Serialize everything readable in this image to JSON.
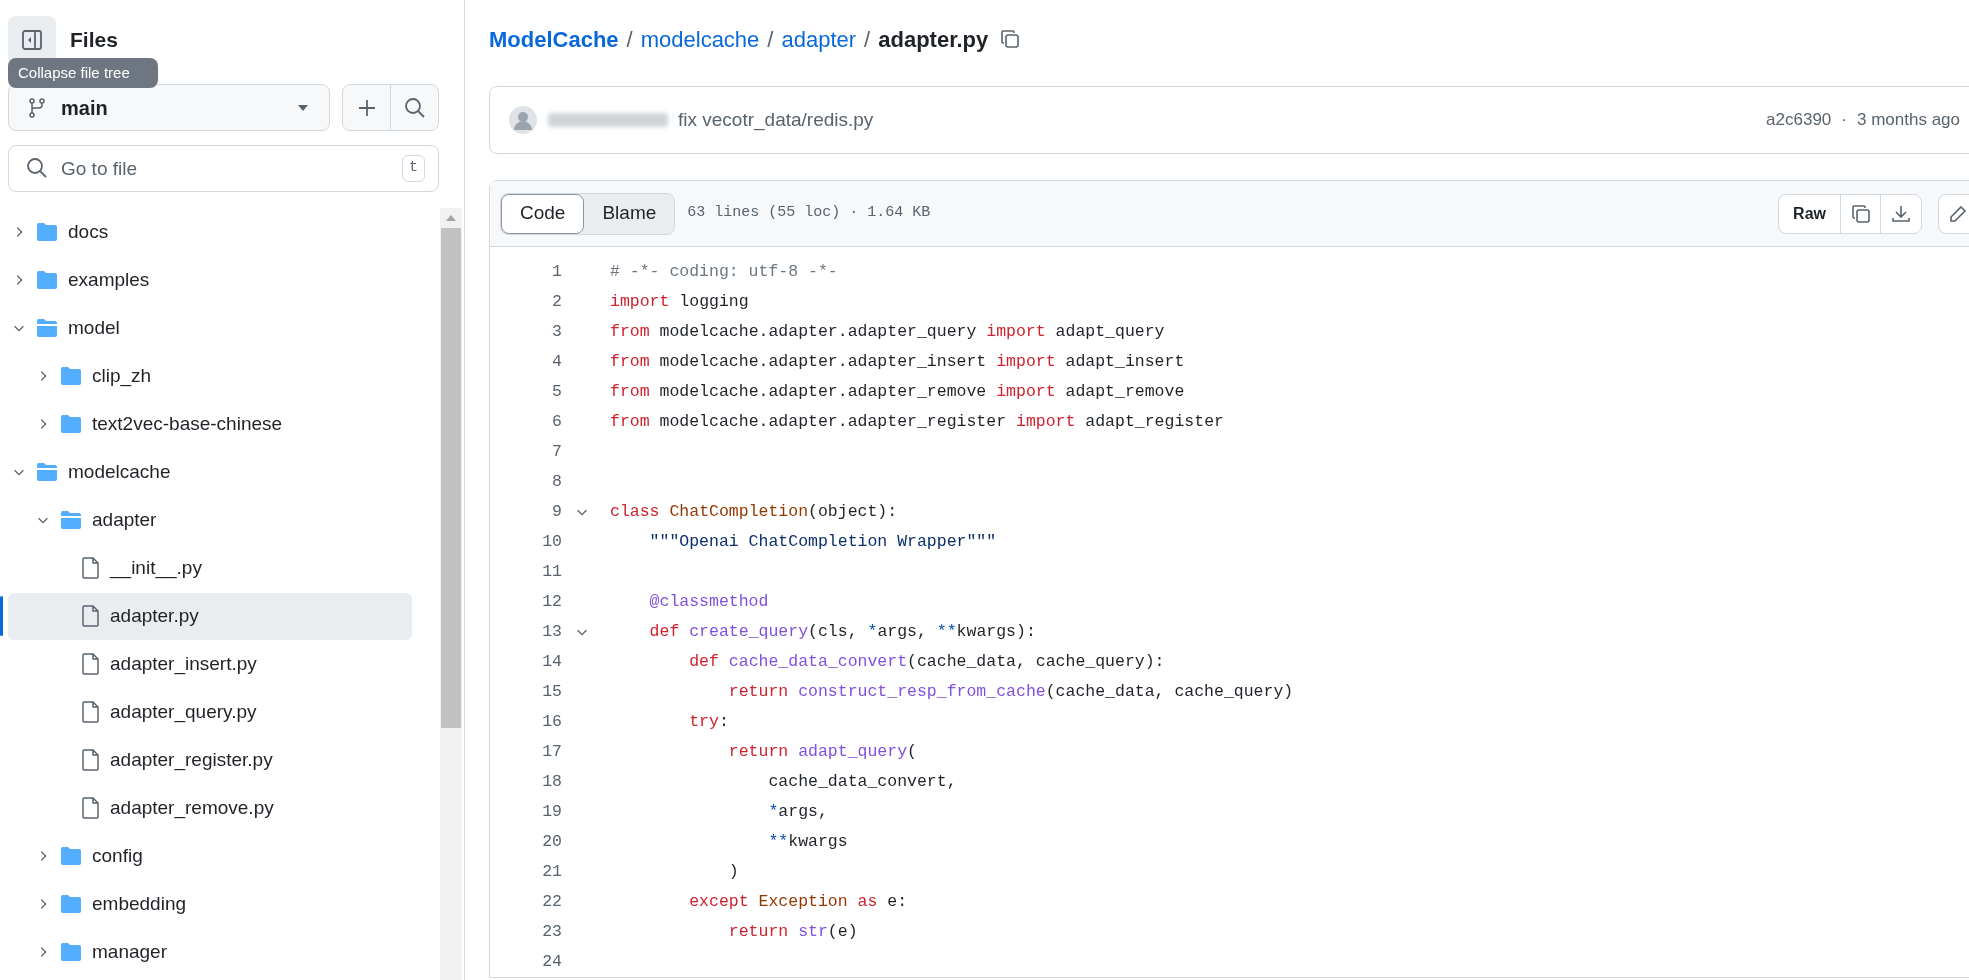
{
  "sidebar": {
    "title": "Files",
    "tooltip": "Collapse file tree",
    "branch": "main",
    "search": {
      "placeholder": "Go to file",
      "shortcut": "t"
    },
    "tree": [
      {
        "kind": "folder",
        "name": "docs",
        "expanded": false,
        "selected": false
      },
      {
        "kind": "folder",
        "name": "examples",
        "expanded": false,
        "selected": false
      },
      {
        "kind": "folder",
        "name": "model",
        "expanded": true,
        "selected": false,
        "children": [
          {
            "kind": "folder",
            "name": "clip_zh",
            "expanded": false,
            "selected": false
          },
          {
            "kind": "folder",
            "name": "text2vec-base-chinese",
            "expanded": false,
            "selected": false
          }
        ]
      },
      {
        "kind": "folder",
        "name": "modelcache",
        "expanded": true,
        "selected": false,
        "children": [
          {
            "kind": "folder",
            "name": "adapter",
            "expanded": true,
            "selected": false,
            "children": [
              {
                "kind": "file",
                "name": "__init__.py",
                "selected": false
              },
              {
                "kind": "file",
                "name": "adapter.py",
                "selected": true
              },
              {
                "kind": "file",
                "name": "adapter_insert.py",
                "selected": false
              },
              {
                "kind": "file",
                "name": "adapter_query.py",
                "selected": false
              },
              {
                "kind": "file",
                "name": "adapter_register.py",
                "selected": false
              },
              {
                "kind": "file",
                "name": "adapter_remove.py",
                "selected": false
              }
            ]
          },
          {
            "kind": "folder",
            "name": "config",
            "expanded": false,
            "selected": false
          },
          {
            "kind": "folder",
            "name": "embedding",
            "expanded": false,
            "selected": false
          },
          {
            "kind": "folder",
            "name": "manager",
            "expanded": false,
            "selected": false
          }
        ]
      }
    ]
  },
  "breadcrumb": {
    "links": [
      "ModelCache",
      "modelcache",
      "adapter"
    ],
    "separator": "/",
    "current": "adapter.py"
  },
  "commit": {
    "message": "fix vecotr_data/redis.py",
    "sha": "a2c6390",
    "separator": "·",
    "time": "3 months ago"
  },
  "file_header": {
    "tabs": [
      {
        "label": "Code",
        "selected": true
      },
      {
        "label": "Blame",
        "selected": false
      }
    ],
    "info": "63 lines (55 loc) · 1.64 KB",
    "raw": "Raw"
  },
  "code": [
    {
      "number": "1",
      "tokens": [
        {
          "kind": "comment",
          "text": "# -*- coding: utf-8 -*-"
        }
      ]
    },
    {
      "number": "2",
      "tokens": [
        {
          "kind": "keyword",
          "text": "import"
        },
        {
          "kind": "plain",
          "text": " logging"
        }
      ]
    },
    {
      "number": "3",
      "tokens": [
        {
          "kind": "keyword",
          "text": "from"
        },
        {
          "kind": "plain",
          "text": " modelcache.adapter.adapter_query "
        },
        {
          "kind": "keyword",
          "text": "import"
        },
        {
          "kind": "plain",
          "text": " adapt_query"
        }
      ]
    },
    {
      "number": "4",
      "tokens": [
        {
          "kind": "keyword",
          "text": "from"
        },
        {
          "kind": "plain",
          "text": " modelcache.adapter.adapter_insert "
        },
        {
          "kind": "keyword",
          "text": "import"
        },
        {
          "kind": "plain",
          "text": " adapt_insert"
        }
      ]
    },
    {
      "number": "5",
      "tokens": [
        {
          "kind": "keyword",
          "text": "from"
        },
        {
          "kind": "plain",
          "text": " modelcache.adapter.adapter_remove "
        },
        {
          "kind": "keyword",
          "text": "import"
        },
        {
          "kind": "plain",
          "text": " adapt_remove"
        }
      ]
    },
    {
      "number": "6",
      "tokens": [
        {
          "kind": "keyword",
          "text": "from"
        },
        {
          "kind": "plain",
          "text": " modelcache.adapter.adapter_register "
        },
        {
          "kind": "keyword",
          "text": "import"
        },
        {
          "kind": "plain",
          "text": " adapt_register"
        }
      ]
    },
    {
      "number": "7"
    },
    {
      "number": "8"
    },
    {
      "number": "9",
      "expanded": true,
      "tokens": [
        {
          "kind": "keyword",
          "text": "class "
        },
        {
          "kind": "class",
          "text": "ChatCompletion"
        },
        {
          "kind": "plain",
          "text": "(object):"
        }
      ]
    },
    {
      "number": "10",
      "tokens": [
        {
          "kind": "string",
          "text": "    \"\"\"Openai ChatCompletion Wrapper\"\"\""
        }
      ]
    },
    {
      "number": "11"
    },
    {
      "number": "12",
      "tokens": [
        {
          "kind": "function",
          "text": "    @classmethod"
        }
      ]
    },
    {
      "number": "13",
      "expanded": true,
      "tokens": [
        {
          "kind": "keyword",
          "text": "    def "
        },
        {
          "kind": "function",
          "text": "create_query"
        },
        {
          "kind": "plain",
          "text": "(cls, "
        },
        {
          "kind": "operator",
          "text": "*"
        },
        {
          "kind": "plain",
          "text": "args, "
        },
        {
          "kind": "operator",
          "text": "**"
        },
        {
          "kind": "plain",
          "text": "kwargs):"
        }
      ]
    },
    {
      "number": "14",
      "tokens": [
        {
          "kind": "keyword",
          "text": "        def "
        },
        {
          "kind": "function",
          "text": "cache_data_convert"
        },
        {
          "kind": "plain",
          "text": "(cache_data, cache_query):"
        }
      ]
    },
    {
      "number": "15",
      "tokens": [
        {
          "kind": "keyword",
          "text": "            return "
        },
        {
          "kind": "function",
          "text": "construct_resp_from_cache"
        },
        {
          "kind": "plain",
          "text": "(cache_data, cache_query)"
        }
      ]
    },
    {
      "number": "16",
      "tokens": [
        {
          "kind": "keyword",
          "text": "        try"
        },
        {
          "kind": "plain",
          "text": ":"
        }
      ]
    },
    {
      "number": "17",
      "tokens": [
        {
          "kind": "keyword",
          "text": "            return "
        },
        {
          "kind": "function",
          "text": "adapt_query"
        },
        {
          "kind": "plain",
          "text": "("
        }
      ]
    },
    {
      "number": "18",
      "tokens": [
        {
          "kind": "plain",
          "text": "                cache_data_convert,"
        }
      ]
    },
    {
      "number": "19",
      "tokens": [
        {
          "kind": "operator",
          "text": "                *"
        },
        {
          "kind": "plain",
          "text": "args,"
        }
      ]
    },
    {
      "number": "20",
      "tokens": [
        {
          "kind": "operator",
          "text": "                **"
        },
        {
          "kind": "plain",
          "text": "kwargs"
        }
      ]
    },
    {
      "number": "21",
      "tokens": [
        {
          "kind": "plain",
          "text": "            )"
        }
      ]
    },
    {
      "number": "22",
      "tokens": [
        {
          "kind": "keyword",
          "text": "        except "
        },
        {
          "kind": "class",
          "text": "Exception "
        },
        {
          "kind": "keyword",
          "text": "as"
        },
        {
          "kind": "plain",
          "text": " e:"
        }
      ]
    },
    {
      "number": "23",
      "tokens": [
        {
          "kind": "keyword",
          "text": "            return "
        },
        {
          "kind": "function",
          "text": "str"
        },
        {
          "kind": "plain",
          "text": "(e)"
        }
      ]
    },
    {
      "number": "24"
    }
  ]
}
